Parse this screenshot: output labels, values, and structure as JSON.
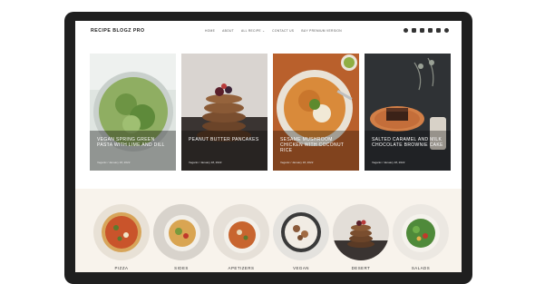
{
  "site": {
    "logo": "RECIPE BLOGZ PRO"
  },
  "nav": {
    "items": [
      "HOME",
      "ABOUT",
      "ALL RECIPE ⌄",
      "CONTACT US",
      "BUY PREMIUM VERSION"
    ]
  },
  "social_icons": [
    "facebook-icon",
    "instagram-icon",
    "youtube-icon",
    "x-icon",
    "tiktok-icon",
    "pinterest-icon"
  ],
  "featured": [
    {
      "title": "VEGAN SPRING GREEN PASTA WITH LIME AND DILL",
      "meta": "Veganic / January 18, 2022"
    },
    {
      "title": "PEANUT BUTTER PANCAKES",
      "meta": "Veganic / January 18, 2022"
    },
    {
      "title": "SESAME MUSHROOM CHICKEN WITH COCONUT RICE",
      "meta": "Veganic / January 18, 2022"
    },
    {
      "title": "SALTED CARAMEL AND MILK CHOCOLATE BROWNIE CAKE",
      "meta": "Veganic / January 18, 2022"
    }
  ],
  "categories": [
    {
      "label": "PIZZA"
    },
    {
      "label": "SIDES"
    },
    {
      "label": "APETIZERS"
    },
    {
      "label": "VEGAN"
    },
    {
      "label": "DESERT"
    },
    {
      "label": "SALADS"
    }
  ]
}
